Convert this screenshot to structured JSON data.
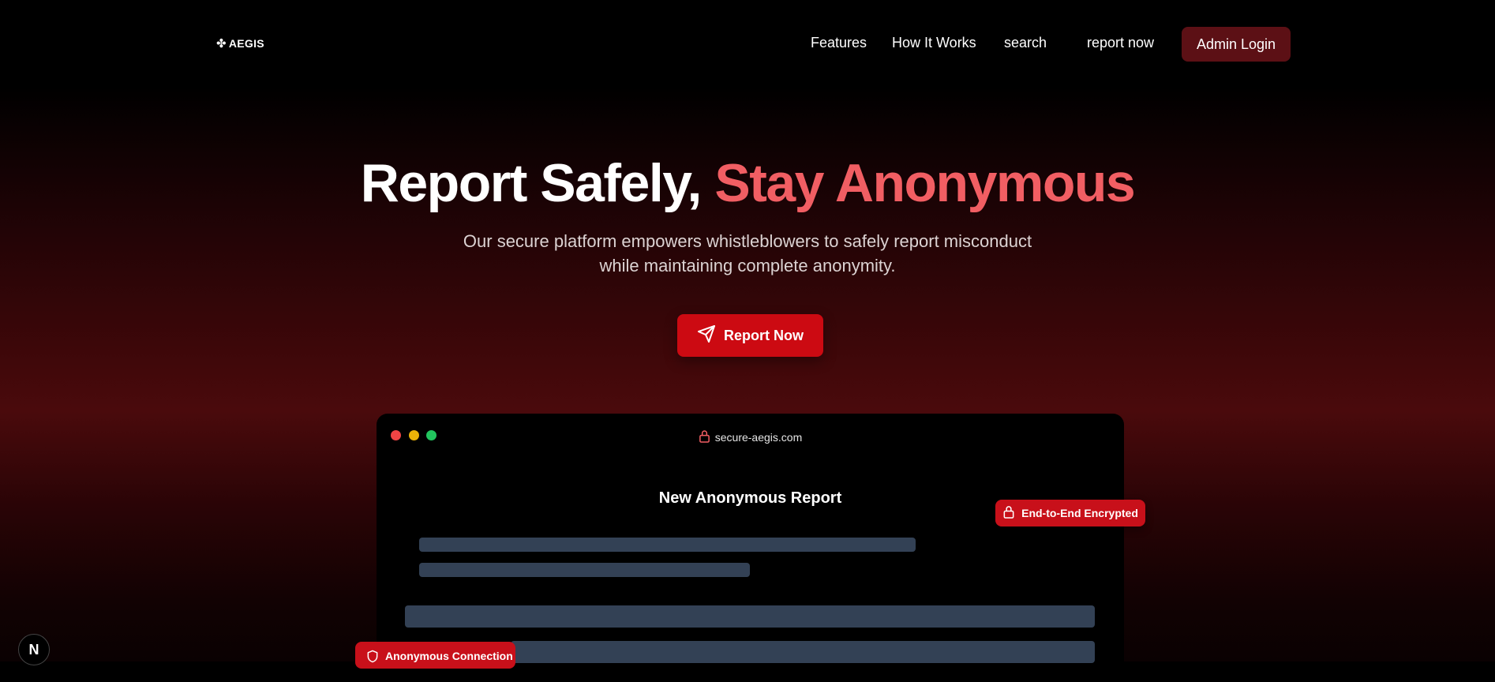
{
  "nav": {
    "logo_glyph": "✤",
    "logo_text": "AEGIS",
    "links": [
      "Features",
      "How It Works",
      "search",
      "report now"
    ],
    "admin_login": "Admin Login"
  },
  "hero": {
    "title_main": "Report Safely,",
    "title_accent": "Stay Anonymous",
    "subtitle_line1": "Our secure platform empowers whistleblowers to safely report misconduct",
    "subtitle_line2": "while maintaining complete anonymity.",
    "cta_label": "Report Now",
    "cta_icon": "send-icon"
  },
  "mockup": {
    "url": "secure-aegis.com",
    "url_icon": "lock-icon",
    "form_title": "New Anonymous Report",
    "encrypted_badge": "End-to-End Encrypted",
    "anonymous_badge": "Anonymous Connection"
  },
  "dev_indicator": "N",
  "colors": {
    "accent": "#f15e63",
    "primary_button": "#cc0a12",
    "admin_button": "#5c1015",
    "skeleton": "#334155"
  }
}
